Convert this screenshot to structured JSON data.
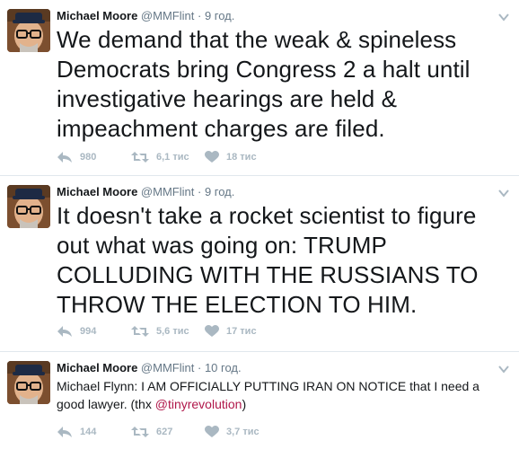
{
  "tweets": [
    {
      "name": "Michael Moore",
      "handle": "@MMFlint",
      "separator": "·",
      "time": "9 год.",
      "text": "We demand that the weak & spineless Democrats bring Congress 2 a halt until investigative hearings are held & impeachment charges are filed.",
      "replies": "980",
      "retweets": "6,1 тис",
      "likes": "18 тис"
    },
    {
      "name": "Michael Moore",
      "handle": "@MMFlint",
      "separator": "·",
      "time": "9 год.",
      "text": "It doesn't take a rocket scientist to figure out what was going on: TRUMP COLLUDING WITH THE RUSSIANS TO THROW THE ELECTION TO HIM.",
      "replies": "994",
      "retweets": "5,6 тис",
      "likes": "17 тис"
    },
    {
      "name": "Michael Moore",
      "handle": "@MMFlint",
      "separator": "·",
      "time": "10 год.",
      "text_before": "Michael Flynn: I AM OFFICIALLY PUTTING IRAN ON NOTICE that I need a good lawyer. (thx ",
      "mention": "@tinyrevolution",
      "text_after": ")",
      "replies": "144",
      "retweets": "627",
      "likes": "3,7 тис"
    }
  ],
  "icons": {
    "reply": "reply-icon",
    "retweet": "retweet-icon",
    "like": "heart-icon",
    "menu": "chevron-down-icon"
  },
  "colors": {
    "icon_gray": "#aab8c2",
    "meta_gray": "#657786",
    "mention": "#b0174a",
    "divider": "#e1e8ed"
  }
}
